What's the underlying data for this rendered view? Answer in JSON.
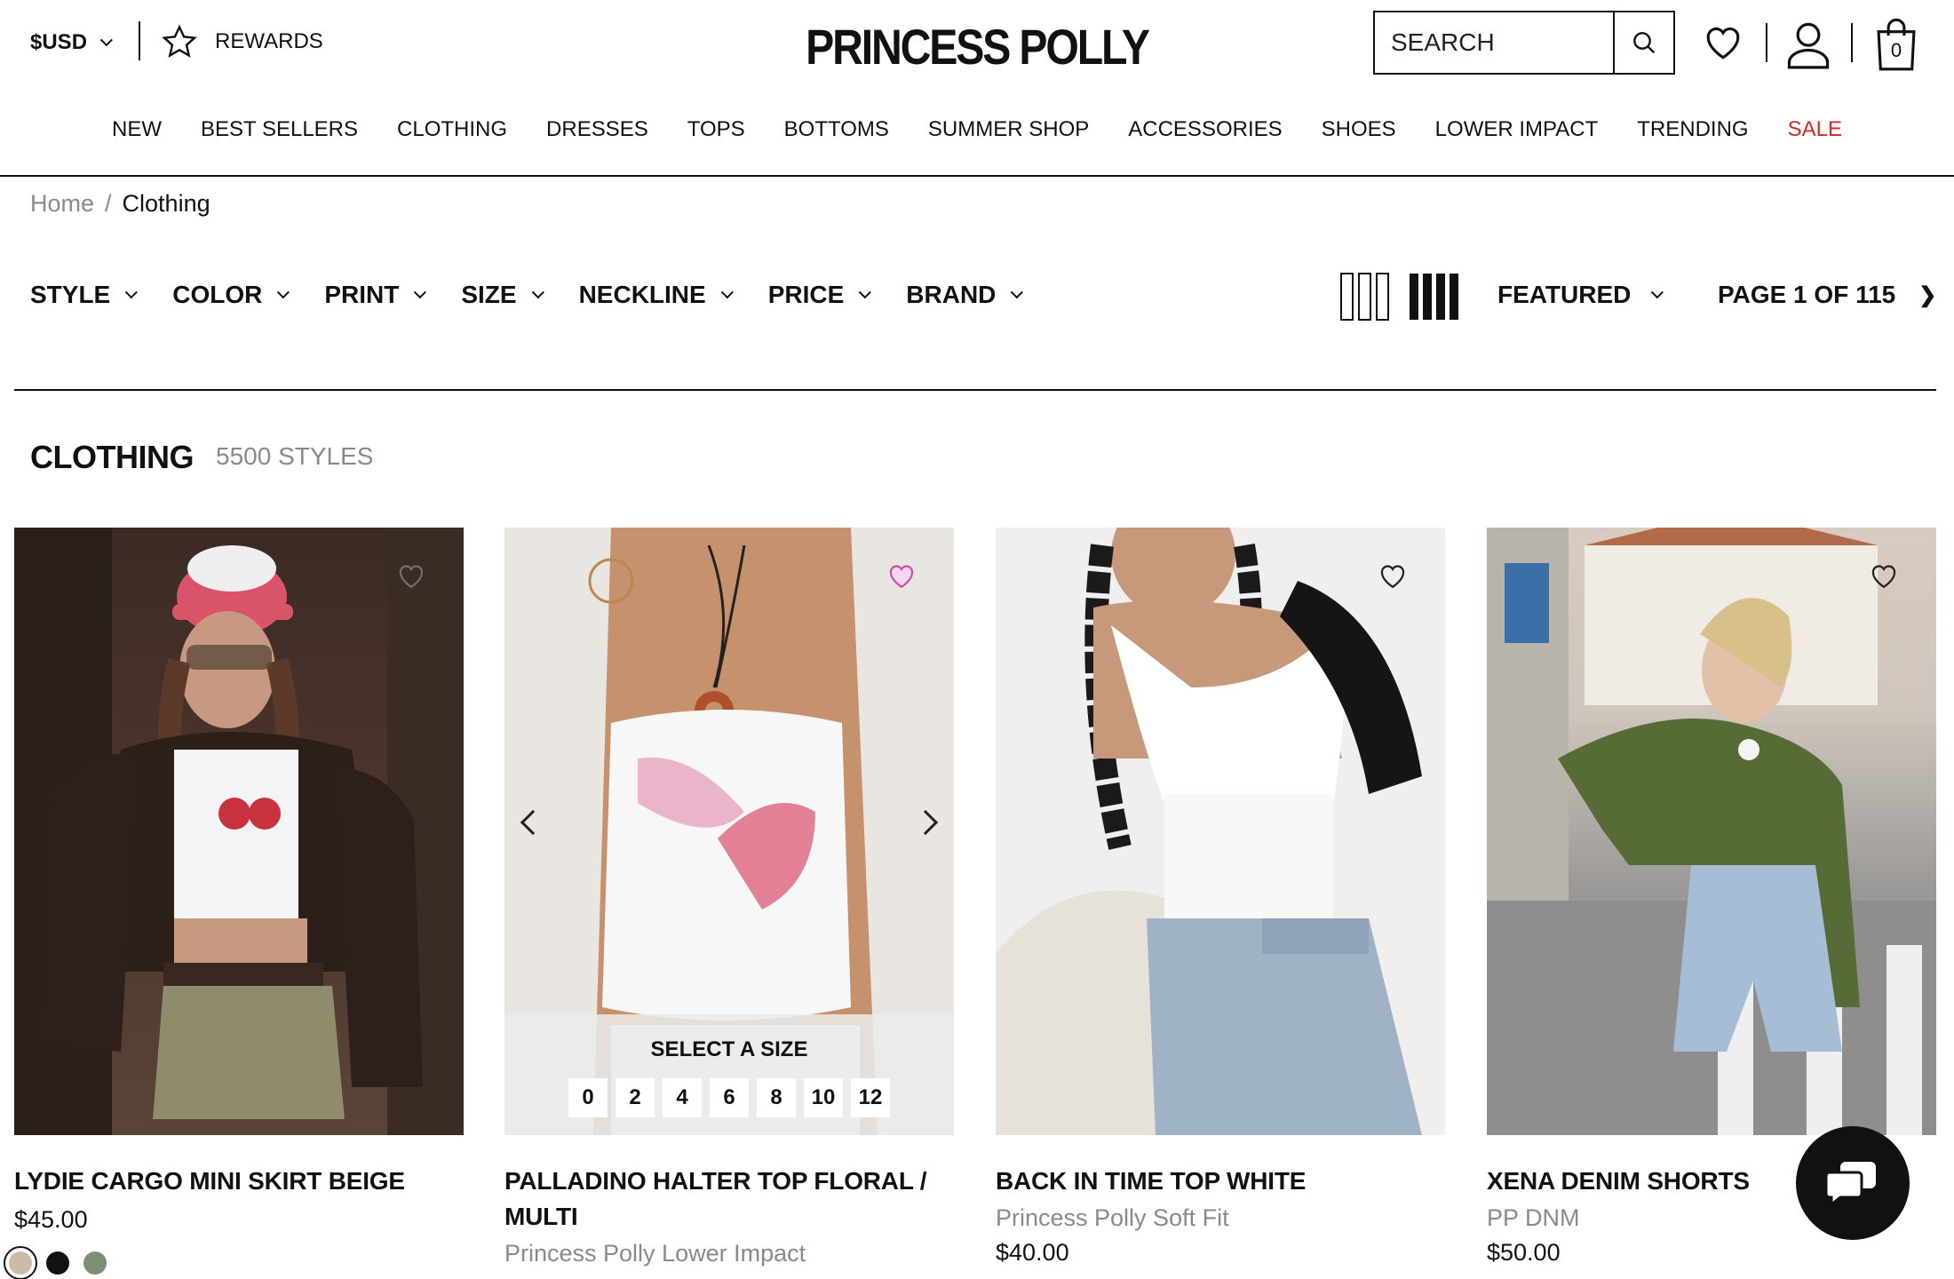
{
  "header": {
    "currency": "$USD",
    "rewards": "REWARDS",
    "logo": "PRINCESS POLLY",
    "search_placeholder": "SEARCH",
    "cart_count": "0"
  },
  "nav": [
    "NEW",
    "BEST SELLERS",
    "CLOTHING",
    "DRESSES",
    "TOPS",
    "BOTTOMS",
    "SUMMER SHOP",
    "ACCESSORIES",
    "SHOES",
    "LOWER IMPACT",
    "TRENDING",
    "SALE"
  ],
  "breadcrumb": {
    "home": "Home",
    "sep": "/",
    "current": "Clothing"
  },
  "filters": [
    "STYLE",
    "COLOR",
    "PRINT",
    "SIZE",
    "NECKLINE",
    "PRICE",
    "BRAND"
  ],
  "sort": {
    "label": "FEATURED"
  },
  "pager": {
    "label": "PAGE 1 OF 115",
    "next": "❯"
  },
  "section": {
    "title": "CLOTHING",
    "count": "5500 STYLES"
  },
  "products": [
    {
      "title": "LYDIE CARGO MINI SKIRT BEIGE",
      "brand": "",
      "price": "$45.00",
      "swatches": [
        "#cbbba6",
        "#111111",
        "#7d8f74"
      ],
      "wishlisted": false
    },
    {
      "title": "PALLADINO HALTER TOP FLORAL / MULTI",
      "brand": "Princess Polly Lower Impact",
      "price": "",
      "sizes_label": "SELECT A SIZE",
      "sizes": [
        "0",
        "2",
        "4",
        "6",
        "8",
        "10",
        "12"
      ],
      "wishlisted": true
    },
    {
      "title": "BACK IN TIME TOP WHITE",
      "brand": "Princess Polly Soft Fit",
      "price": "$40.00",
      "wishlisted": false
    },
    {
      "title": "XENA DENIM SHORTS",
      "brand": "PP DNM",
      "price": "$50.00",
      "wishlisted": false
    }
  ],
  "colors": {
    "sale": "#d02a2a",
    "text": "#111111",
    "muted": "#8a8a8a",
    "wishlist_active": "#c94fa6"
  }
}
